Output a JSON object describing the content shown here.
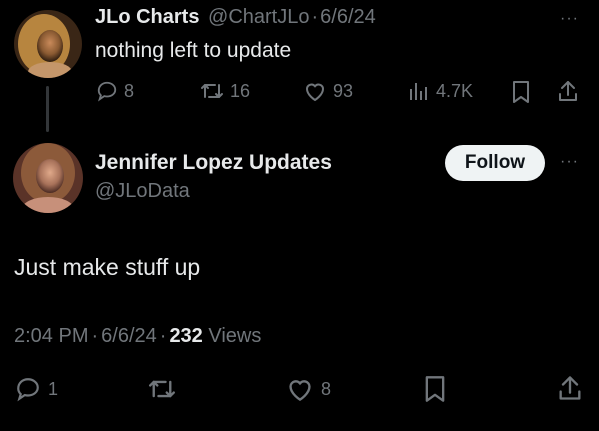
{
  "parent_tweet": {
    "display_name": "JLo Charts",
    "handle": "@ChartJLo",
    "separator": "·",
    "date": "6/6/24",
    "text": "nothing left to update",
    "replies": "8",
    "reposts": "16",
    "likes": "93",
    "views": "4.7K",
    "more": "···"
  },
  "main_tweet": {
    "display_name": "Jennifer Lopez Updates",
    "handle": "@JLoData",
    "follow_label": "Follow",
    "more": "···",
    "text": "Just make stuff up",
    "time": "2:04 PM",
    "sep1": "·",
    "date": "6/6/24",
    "sep2": "·",
    "views_count": "232",
    "views_label": "Views",
    "replies": "1",
    "likes": "8"
  },
  "colors": {
    "background": "#000000",
    "text": "#e7e9ea",
    "muted": "#71767b",
    "thread_line": "#333639",
    "follow_bg": "#eff3f4"
  }
}
